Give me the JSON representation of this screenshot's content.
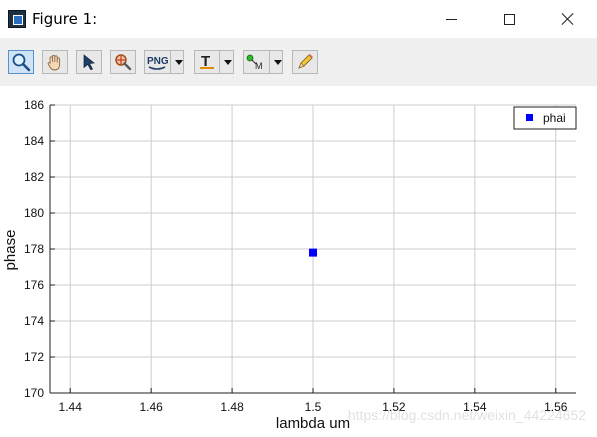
{
  "window": {
    "title": "Figure 1:"
  },
  "toolbar": {
    "tools": [
      {
        "name": "zoom",
        "icon": "magnifier-icon",
        "active": true
      },
      {
        "name": "pan",
        "icon": "hand-icon"
      },
      {
        "name": "select",
        "icon": "arrow-cursor-icon"
      },
      {
        "name": "datatip",
        "icon": "datatip-icon"
      },
      {
        "name": "export",
        "icon": "png-icon",
        "label": "PNG"
      },
      {
        "name": "text",
        "icon": "text-tool-icon",
        "label": "T"
      },
      {
        "name": "marker",
        "icon": "marker-icon",
        "label": "M"
      },
      {
        "name": "edit",
        "icon": "pencil-icon"
      }
    ]
  },
  "chart_data": {
    "type": "scatter",
    "title": "",
    "xlabel": "lambda um",
    "ylabel": "phase",
    "xlim": [
      1.435,
      1.565
    ],
    "ylim": [
      170,
      186
    ],
    "xticks": [
      "1.44",
      "1.46",
      "1.48",
      "1.5",
      "1.52",
      "1.54",
      "1.56"
    ],
    "xtick_values": [
      1.44,
      1.46,
      1.48,
      1.5,
      1.52,
      1.54,
      1.56
    ],
    "yticks": [
      "170",
      "172",
      "174",
      "176",
      "178",
      "180",
      "182",
      "184",
      "186"
    ],
    "ytick_values": [
      170,
      172,
      174,
      176,
      178,
      180,
      182,
      184,
      186
    ],
    "grid": true,
    "legend_position": "top-right",
    "series": [
      {
        "name": "phai",
        "color": "#0000ff",
        "marker": "square",
        "x": [
          1.5
        ],
        "y": [
          177.8
        ]
      }
    ]
  },
  "watermark": "https://blog.csdn.net/weixin_44224652"
}
